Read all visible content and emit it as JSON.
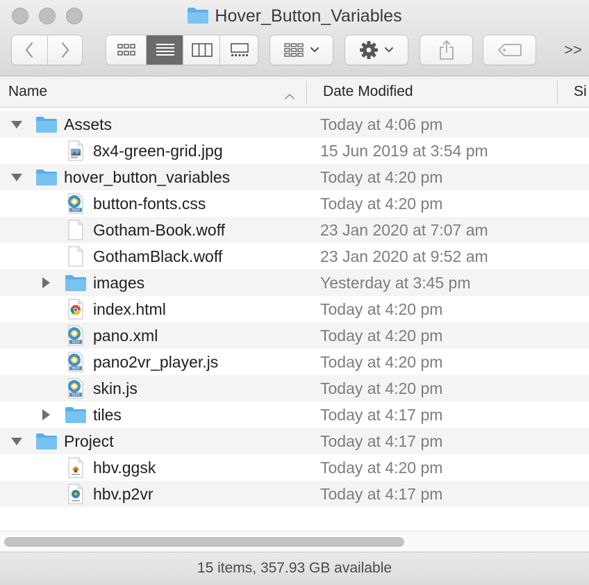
{
  "window": {
    "title": "Hover_Button_Variables"
  },
  "toolbar": {
    "back_icon": "chevron-left-icon",
    "forward_icon": "chevron-right-icon",
    "view_modes": [
      "icon-view",
      "list-view",
      "column-view",
      "gallery-view"
    ],
    "active_view": "list-view",
    "group_icon": "group-by-grid-icon",
    "action_icon": "gear-icon",
    "share_icon": "share-icon",
    "tag_icon": "tag-icon",
    "overflow_label": ">>"
  },
  "header": {
    "name": "Name",
    "date_modified": "Date Modified",
    "size_truncated": "Si",
    "sort_icon": "sort-ascending-chevron-icon"
  },
  "files": [
    {
      "name": "Assets",
      "date": "Today at 4:06 pm",
      "kind": "folder",
      "level": 0,
      "disclosure": "expanded"
    },
    {
      "name": "8x4-green-grid.jpg",
      "date": "15 Jun 2019 at 3:54 pm",
      "kind": "image",
      "level": 1,
      "disclosure": "none"
    },
    {
      "name": "hover_button_variables",
      "date": "Today at 4:20 pm",
      "kind": "folder",
      "level": 0,
      "disclosure": "expanded"
    },
    {
      "name": "button-fonts.css",
      "date": "Today at 4:20 pm",
      "kind": "text-doc",
      "level": 1,
      "disclosure": "none"
    },
    {
      "name": "Gotham-Book.woff",
      "date": "23 Jan 2020 at 7:07 am",
      "kind": "blank",
      "level": 1,
      "disclosure": "none"
    },
    {
      "name": "GothamBlack.woff",
      "date": "23 Jan 2020 at 9:52 am",
      "kind": "blank",
      "level": 1,
      "disclosure": "none"
    },
    {
      "name": "images",
      "date": "Yesterday at 3:45 pm",
      "kind": "folder",
      "level": 1,
      "disclosure": "collapsed"
    },
    {
      "name": "index.html",
      "date": "Today at 4:20 pm",
      "kind": "chrome-doc",
      "level": 1,
      "disclosure": "none"
    },
    {
      "name": "pano.xml",
      "date": "Today at 4:20 pm",
      "kind": "text-doc",
      "level": 1,
      "disclosure": "none"
    },
    {
      "name": "pano2vr_player.js",
      "date": "Today at 4:20 pm",
      "kind": "text-doc",
      "level": 1,
      "disclosure": "none"
    },
    {
      "name": "skin.js",
      "date": "Today at 4:20 pm",
      "kind": "text-doc",
      "level": 1,
      "disclosure": "none"
    },
    {
      "name": "tiles",
      "date": "Today at 4:17 pm",
      "kind": "folder",
      "level": 1,
      "disclosure": "collapsed"
    },
    {
      "name": "Project",
      "date": "Today at 4:17 pm",
      "kind": "folder",
      "level": 0,
      "disclosure": "expanded"
    },
    {
      "name": "hbv.ggsk",
      "date": "Today at 4:20 pm",
      "kind": "skin-doc",
      "level": 1,
      "disclosure": "none"
    },
    {
      "name": "hbv.p2vr",
      "date": "Today at 4:17 pm",
      "kind": "p2vr-doc",
      "level": 1,
      "disclosure": "none"
    }
  ],
  "status": {
    "text": "15 items, 357.93 GB available"
  },
  "colors": {
    "folder_blue": "#6cb8ec",
    "date_gray": "#7d7d7d",
    "active_segment": "#6b6b6b"
  }
}
